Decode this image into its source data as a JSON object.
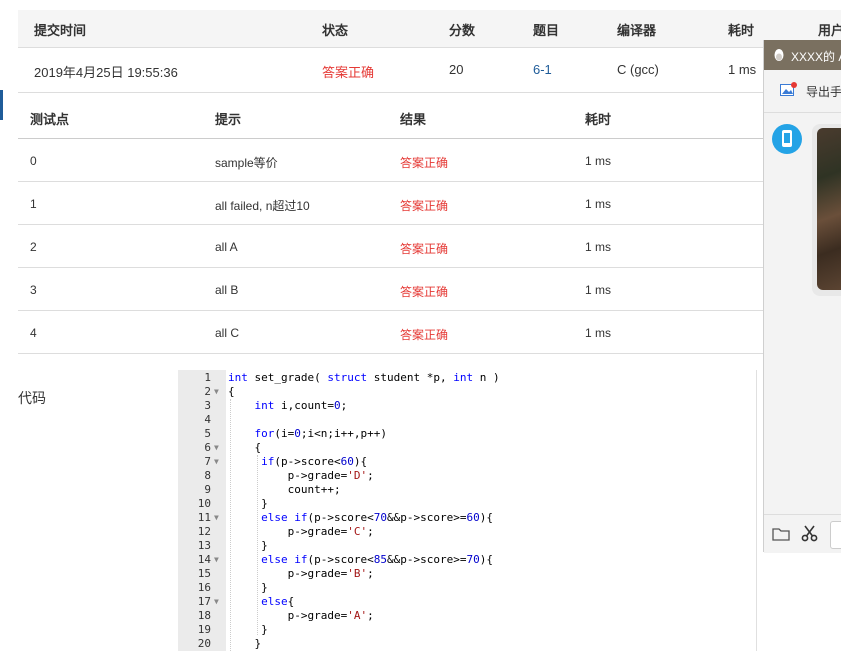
{
  "submission": {
    "headers": [
      "提交时间",
      "状态",
      "分数",
      "题目",
      "编译器",
      "耗时",
      "用户"
    ],
    "row": {
      "time": "2019年4月25日 19:55:36",
      "status": "答案正确",
      "score": "20",
      "problem": "6-1",
      "compiler": "C (gcc)",
      "elapsed": "1 ms"
    }
  },
  "tests": {
    "headers": [
      "测试点",
      "提示",
      "结果",
      "耗时"
    ],
    "rows": [
      {
        "id": "0",
        "hint": "sample等价",
        "result": "答案正确",
        "time": "1 ms"
      },
      {
        "id": "1",
        "hint": "all failed, n超过10",
        "result": "答案正确",
        "time": "1 ms"
      },
      {
        "id": "2",
        "hint": "all A",
        "result": "答案正确",
        "time": "1 ms"
      },
      {
        "id": "3",
        "hint": "all B",
        "result": "答案正确",
        "time": "1 ms"
      },
      {
        "id": "4",
        "hint": "all C",
        "result": "答案正确",
        "time": "1 ms"
      }
    ]
  },
  "code": {
    "label": "代码",
    "lines": [
      "int set_grade( struct student *p, int n )",
      "{",
      "    int i,count=0;",
      "",
      "    for(i=0;i<n;i++,p++)",
      "    {",
      "     if(p->score<60){",
      "         p->grade='D';",
      "         count++;",
      "     }",
      "     else if(p->score<70&&p->score>=60){",
      "         p->grade='C';",
      "     }",
      "     else if(p->score<85&&p->score>=70){",
      "         p->grade='B';",
      "     }",
      "     else{",
      "         p->grade='A';",
      "     }",
      "    }"
    ],
    "folds": [
      2,
      6,
      7,
      11,
      14,
      17
    ]
  },
  "chat": {
    "title": "XXXX的 A",
    "export_label": "导出手"
  },
  "colors": {
    "accepted": "#e53935",
    "link": "#1f5c99",
    "chat_title": "#7a7060",
    "avatar": "#24a3e6"
  },
  "icons": [
    "qq-penguin-icon",
    "export-image-icon",
    "avatar-icon",
    "folder-icon",
    "scissors-icon",
    "fold-arrow-icon"
  ]
}
